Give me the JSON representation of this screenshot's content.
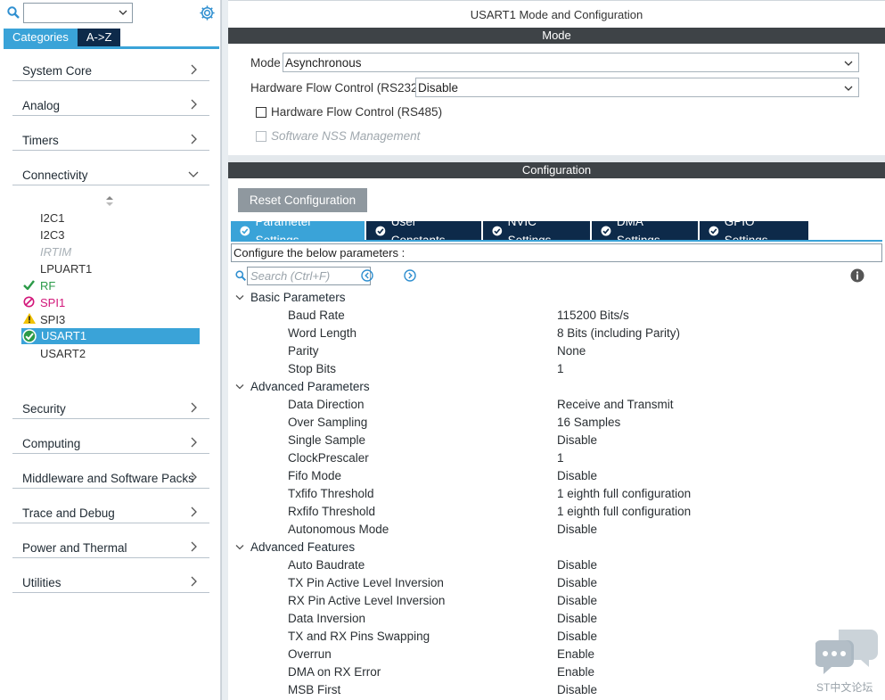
{
  "left": {
    "tabs": [
      "Categories",
      "A->Z"
    ],
    "categories": [
      {
        "label": "System Core"
      },
      {
        "label": "Analog"
      },
      {
        "label": "Timers"
      },
      {
        "label": "Connectivity"
      },
      {
        "label": "Security"
      },
      {
        "label": "Computing"
      },
      {
        "label": "Middleware and Software Packs"
      },
      {
        "label": "Trace and Debug"
      },
      {
        "label": "Power and Thermal"
      },
      {
        "label": "Utilities"
      }
    ],
    "connectivity_items": [
      "I2C1",
      "I2C3",
      "IRTIM",
      "LPUART1",
      "RF",
      "SPI1",
      "SPI3",
      "USART1",
      "USART2"
    ]
  },
  "right": {
    "title": "USART1 Mode and Configuration",
    "mode_bar": "Mode",
    "mode_label": "Mode",
    "mode_value": "Asynchronous",
    "hfc232_label": "Hardware Flow Control (RS232)",
    "hfc232_value": "Disable",
    "hfc485_label": "Hardware Flow Control (RS485)",
    "nss_label": "Software NSS Management",
    "config_bar": "Configuration",
    "reset_button": "Reset Configuration",
    "tabs": [
      "Parameter Settings",
      "User Constants",
      "NVIC Settings",
      "DMA Settings",
      "GPIO Settings"
    ],
    "configure_text": "Configure the below parameters :",
    "search_placeholder": "Search (Ctrl+F)",
    "groups": [
      {
        "name": "Basic Parameters",
        "params": [
          {
            "name": "Baud Rate",
            "value": "115200 Bits/s"
          },
          {
            "name": "Word Length",
            "value": "8 Bits (including Parity)"
          },
          {
            "name": "Parity",
            "value": "None"
          },
          {
            "name": "Stop Bits",
            "value": "1"
          }
        ]
      },
      {
        "name": "Advanced Parameters",
        "params": [
          {
            "name": "Data Direction",
            "value": "Receive and Transmit"
          },
          {
            "name": "Over Sampling",
            "value": "16 Samples"
          },
          {
            "name": "Single Sample",
            "value": "Disable"
          },
          {
            "name": "ClockPrescaler",
            "value": "1"
          },
          {
            "name": "Fifo Mode",
            "value": "Disable"
          },
          {
            "name": "Txfifo Threshold",
            "value": "1 eighth full configuration"
          },
          {
            "name": "Rxfifo Threshold",
            "value": "1 eighth full configuration"
          },
          {
            "name": "Autonomous Mode",
            "value": "Disable"
          }
        ]
      },
      {
        "name": "Advanced Features",
        "params": [
          {
            "name": "Auto Baudrate",
            "value": "Disable"
          },
          {
            "name": "TX Pin Active Level Inversion",
            "value": "Disable"
          },
          {
            "name": "RX Pin Active Level Inversion",
            "value": "Disable"
          },
          {
            "name": "Data Inversion",
            "value": "Disable"
          },
          {
            "name": "TX and RX Pins Swapping",
            "value": "Disable"
          },
          {
            "name": "Overrun",
            "value": "Enable"
          },
          {
            "name": "DMA on RX Error",
            "value": "Enable"
          },
          {
            "name": "MSB First",
            "value": "Disable"
          }
        ]
      }
    ]
  },
  "watermark": "ST中文论坛",
  "colors": {
    "accent": "#3aa3d8",
    "navy": "#0d2a4a",
    "bar": "#3e4347",
    "green": "#2b9a48",
    "pink": "#d2177a",
    "warn": "#f2c200"
  }
}
